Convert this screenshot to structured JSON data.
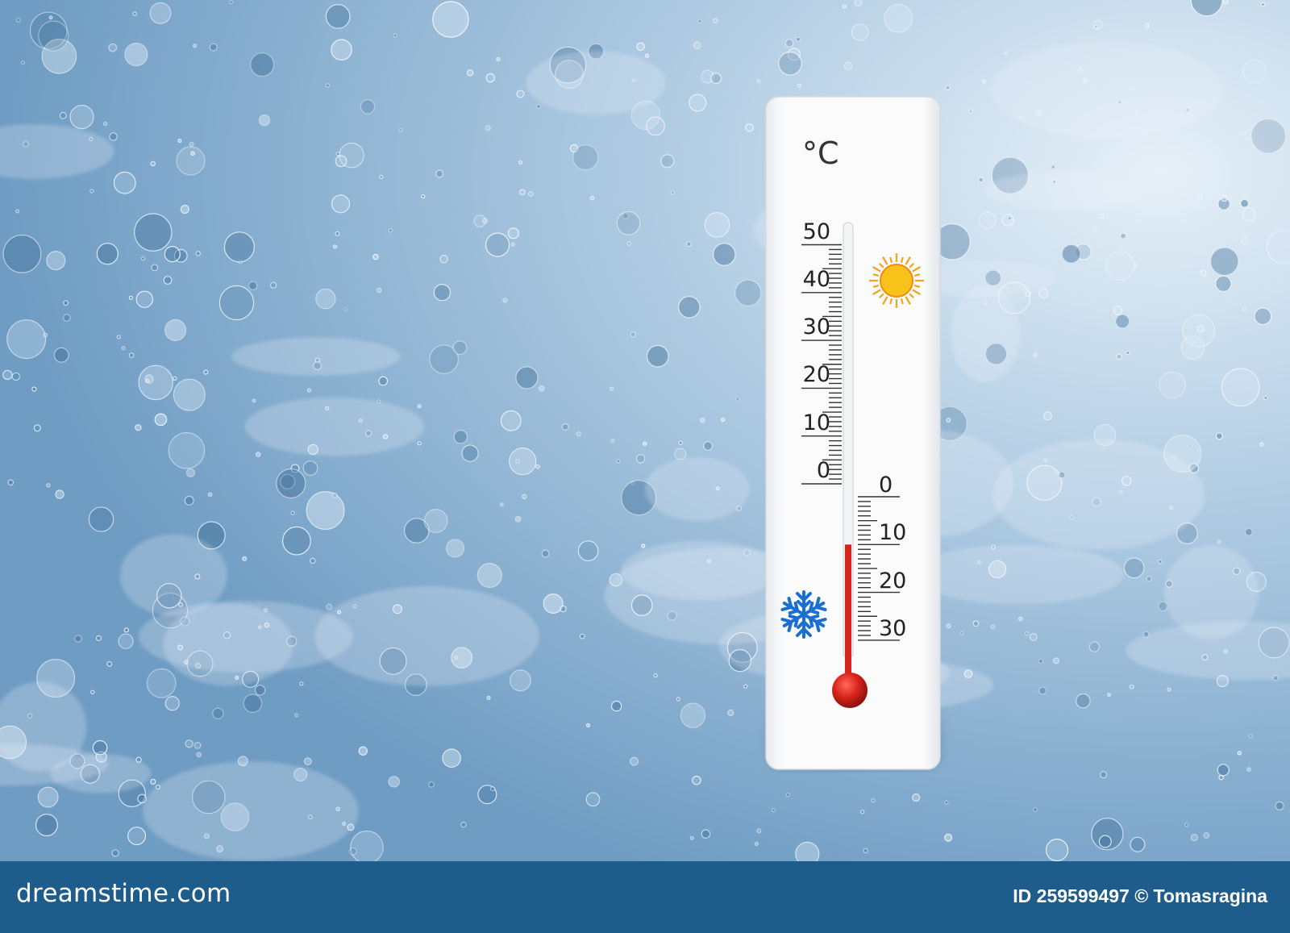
{
  "thermometer": {
    "unit": "°C",
    "scale_positive": [
      "50",
      "40",
      "30",
      "20",
      "10",
      "0"
    ],
    "scale_negative": [
      "0",
      "10",
      "20",
      "30"
    ],
    "reading_celsius": -10,
    "colors": {
      "mercury": "#d8231b",
      "body": "#f7f8f9",
      "sun": "#f5a31a",
      "snowflake": "#1a6fd1"
    },
    "icons": [
      "sun-icon",
      "snowflake-icon"
    ]
  },
  "footer": {
    "brand": "dreamstime.com",
    "credit": "ID 259599497 © Tomasragina"
  },
  "background": {
    "description_color": "#8fb3d3"
  }
}
